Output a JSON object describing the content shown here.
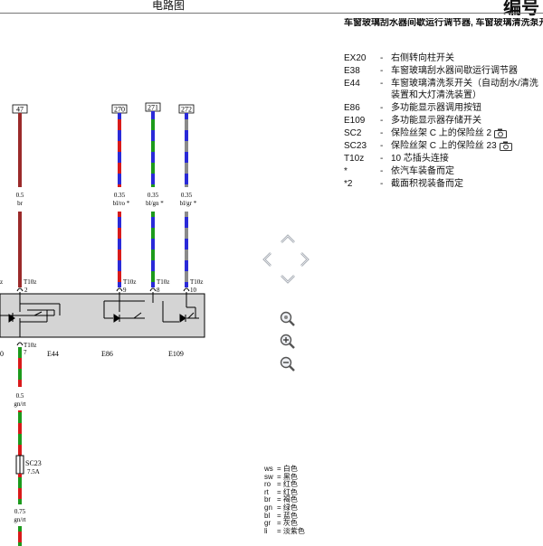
{
  "header": {
    "title": "电路图",
    "number_label": "编号"
  },
  "legend": {
    "title": "车窗玻璃刮水器间歇运行调节器, 车窗玻璃清洗泵开关(自动刮水/清洗装置和大灯清洗装置), 多功能显示器调用按钮, 多功能显示器存储开关",
    "items": [
      {
        "code": "EX20",
        "desc": "右侧转向柱开关"
      },
      {
        "code": "E38",
        "desc": "车窗玻璃刮水器间歇运行调节器"
      },
      {
        "code": "E44",
        "desc": "车窗玻璃清洗泵开关（自动刮水/清洗装置和大灯清洗装置）"
      },
      {
        "code": "E86",
        "desc": "多功能显示器调用按钮"
      },
      {
        "code": "E109",
        "desc": "多功能显示器存储开关"
      },
      {
        "code": "SC2",
        "desc": "保险丝架 C 上的保险丝 2",
        "icon": "camera-icon"
      },
      {
        "code": "SC23",
        "desc": "保险丝架 C 上的保险丝 23",
        "icon": "camera-icon"
      },
      {
        "code": "T10z",
        "desc": "10 芯插头连接"
      },
      {
        "code": "*",
        "desc": "依汽车装备而定"
      },
      {
        "code": "*2",
        "desc": "截面积视装备而定"
      }
    ]
  },
  "diagram": {
    "wires": [
      {
        "ref": "47",
        "gauge": "0.5",
        "color": "br",
        "pin": "2"
      },
      {
        "ref": "270",
        "gauge": "0.35",
        "color": "bl/ro *",
        "pin": "9"
      },
      {
        "ref": "271",
        "gauge": "0.35",
        "color": "bl/gn *",
        "pin": "8"
      },
      {
        "ref": "272",
        "gauge": "0.35",
        "color": "bl/gr *",
        "pin": "10"
      }
    ],
    "connector": "T10z",
    "left_connector_fragment": "z",
    "components": [
      "E44",
      "E86",
      "E109"
    ],
    "lower": {
      "connector": "T10z",
      "pin": "7",
      "wire1_gauge": "0.5",
      "wire1_color": "gn/rt",
      "fuse": "SC23",
      "fuse_rating": "7.5A",
      "wire2_gauge": "0.75",
      "wire2_color": "gn/rt"
    },
    "wire_colors": {
      "br": "#9b2a2a",
      "bl": "#2a2ad8",
      "ro": "#d81a1a",
      "rt": "#d81a1a",
      "gn": "#1c9a1c",
      "gr": "#8a8a8a"
    }
  },
  "color_key": [
    {
      "abbr": "ws",
      "meaning": "= 白色"
    },
    {
      "abbr": "sw",
      "meaning": "= 黑色"
    },
    {
      "abbr": "ro",
      "meaning": "= 红色"
    },
    {
      "abbr": "rt",
      "meaning": "= 红色"
    },
    {
      "abbr": "br",
      "meaning": "= 褐色"
    },
    {
      "abbr": "gn",
      "meaning": "= 绿色"
    },
    {
      "abbr": "bl",
      "meaning": "= 蓝色"
    },
    {
      "abbr": "gr",
      "meaning": "= 灰色"
    },
    {
      "abbr": "li",
      "meaning": "= 淡紫色"
    }
  ],
  "nav_icons": [
    "arrow-up-icon",
    "arrow-left-icon",
    "arrow-right-icon",
    "arrow-down-icon",
    "zoom-fit-icon",
    "zoom-in-icon",
    "zoom-out-icon"
  ]
}
